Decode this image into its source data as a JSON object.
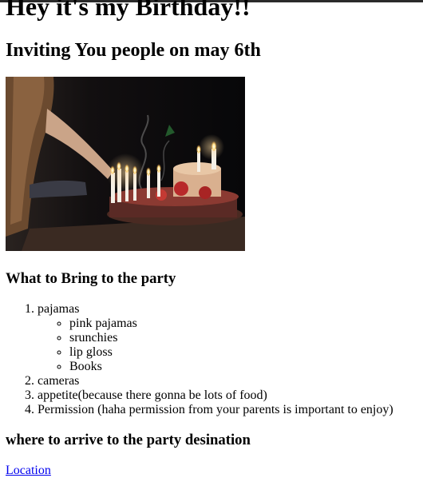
{
  "page": {
    "title": "Hey it's my Birthday!!",
    "subtitle": "Inviting You people on may 6th"
  },
  "photo": {
    "icon": "birthday-cake-photo"
  },
  "bring": {
    "heading": "What to Bring to the party",
    "items": [
      {
        "label": "pajamas",
        "sub_items": [
          "pink pajamas",
          "srunchies",
          "lip gloss",
          "Books"
        ]
      },
      {
        "label": "cameras"
      },
      {
        "label": "appetite(because there gonna be lots of food)"
      },
      {
        "label": "Permission (haha permission from your parents is important to enjoy)"
      }
    ]
  },
  "arrive": {
    "heading": "where to arrive to the party desination",
    "link_label": "Location"
  },
  "colors": {
    "link": "#0000ee",
    "background": "#ffffff",
    "text": "#000000"
  }
}
